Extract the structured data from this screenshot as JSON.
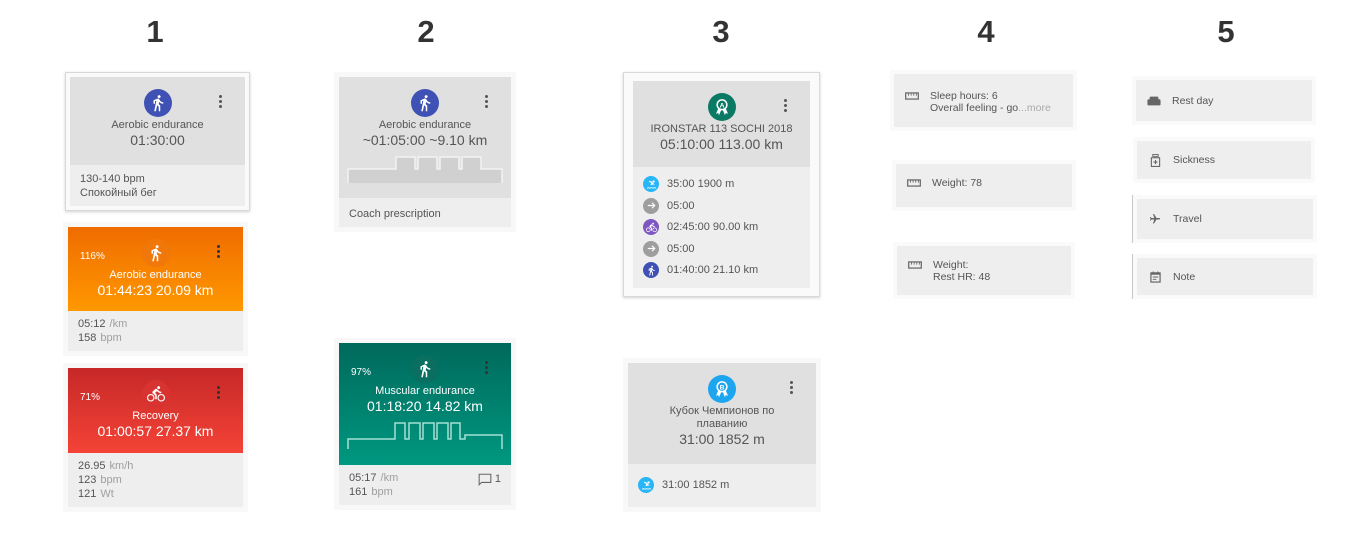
{
  "columns": [
    "1",
    "2",
    "3",
    "4",
    "5"
  ],
  "column1": {
    "planned": {
      "icon": "run-icon",
      "title": "Aerobic endurance",
      "duration": "01:30:00",
      "footer": [
        "130-140 bpm",
        "Спокойный бег"
      ]
    },
    "completed_run": {
      "percent": "116%",
      "icon": "run-icon",
      "title": "Aerobic endurance",
      "summary": "01:44:23  20.09 km",
      "stats": [
        {
          "value": "05:12",
          "unit": "/km"
        },
        {
          "value": "158",
          "unit": "bpm"
        }
      ],
      "color": "#ff8c00"
    },
    "completed_bike": {
      "percent": "71%",
      "icon": "bike-icon",
      "title": "Recovery",
      "summary": "01:00:57  27.37 km",
      "stats": [
        {
          "value": "26.95",
          "unit": "km/h"
        },
        {
          "value": "123",
          "unit": "bpm"
        },
        {
          "value": "121",
          "unit": "Wt"
        }
      ],
      "color": "#e53935"
    }
  },
  "column2": {
    "planned": {
      "icon": "run-icon",
      "title": "Aerobic endurance",
      "summary": "~01:05:00  ~9.10 km",
      "footer": "Coach prescription"
    },
    "completed": {
      "percent": "97%",
      "icon": "run-icon",
      "title": "Muscular endurance",
      "summary": "01:18:20  14.82 km",
      "stats": [
        {
          "value": "05:17",
          "unit": "/km"
        },
        {
          "value": "161",
          "unit": "bpm"
        }
      ],
      "comments": "1",
      "color": "#00897b"
    }
  },
  "column3": {
    "race_a": {
      "badge": "A",
      "title": "IRONSTAR 113 SOCHI 2018",
      "summary": "05:10:00  113.00 km",
      "segments": [
        {
          "icon": "swim-icon",
          "text": "35:00  1900 m",
          "color": "#29b6f6"
        },
        {
          "icon": "transition-icon",
          "text": "05:00",
          "color": "#9e9e9e"
        },
        {
          "icon": "bike-icon",
          "text": "02:45:00  90.00 km",
          "color": "#7e57c2"
        },
        {
          "icon": "transition-icon",
          "text": "05:00",
          "color": "#9e9e9e"
        },
        {
          "icon": "run-icon",
          "text": "01:40:00  21.10 km",
          "color": "#3f51b5"
        }
      ]
    },
    "race_b": {
      "badge": "B",
      "title": "Кубок Чемпионов по плаванию",
      "summary": "31:00  1852 m",
      "segments": [
        {
          "icon": "swim-icon",
          "text": "31:00  1852 m",
          "color": "#29b6f6"
        }
      ]
    }
  },
  "column4": {
    "notes": [
      {
        "icon": "ruler-icon",
        "line1": "Sleep hours: 6",
        "line2": "Overall feeling - go",
        "more": "...more"
      },
      {
        "icon": "ruler-icon",
        "line1": "Weight: 78"
      },
      {
        "icon": "ruler-icon",
        "line1": "Weight:",
        "line2": "Rest HR: 48"
      }
    ]
  },
  "column5": {
    "items": [
      {
        "icon": "sofa-icon",
        "label": "Rest day"
      },
      {
        "icon": "medicine-icon",
        "label": "Sickness"
      },
      {
        "icon": "airplane-icon",
        "label": "Travel"
      },
      {
        "icon": "calendar-note-icon",
        "label": "Note"
      }
    ]
  }
}
